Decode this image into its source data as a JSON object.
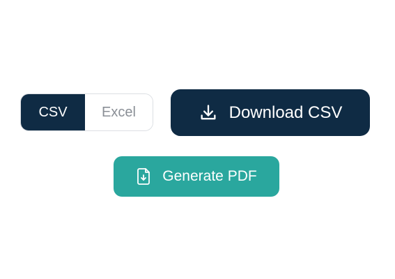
{
  "format_toggle": {
    "options": [
      {
        "label": "CSV",
        "selected": true
      },
      {
        "label": "Excel",
        "selected": false
      }
    ]
  },
  "download_button": {
    "label": "Download CSV",
    "icon": "download-icon"
  },
  "generate_pdf_button": {
    "label": "Generate PDF",
    "icon": "file-download-icon"
  },
  "colors": {
    "primary_dark": "#0f2b44",
    "accent_teal": "#2aa79e",
    "inactive_text": "#8a8f96",
    "toggle_border": "#dcdfe3",
    "background": "#ffffff"
  }
}
